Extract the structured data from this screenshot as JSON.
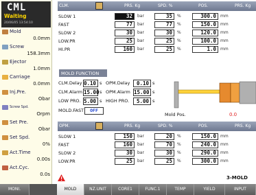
{
  "app": {
    "logo": "CML",
    "status": "Waiting",
    "datetime": "20/06/05 13:54:10"
  },
  "left_stats": [
    {
      "label": "Mold",
      "value": "0.0mm",
      "color": "#c08040"
    },
    {
      "label": "Screw",
      "value": "158.3mm",
      "color": "#80a0c0"
    },
    {
      "label": "Ejector",
      "value": "1.0mm",
      "color": "#c0a040"
    },
    {
      "label": "Carriage",
      "value": "0.0mm",
      "color": "#e8b040"
    },
    {
      "label": "Inj.Pre.",
      "value": "Obar",
      "color": "#d09040"
    },
    {
      "label": "Screw Spd.",
      "value": "Orpm",
      "color": "#8080c0"
    },
    {
      "label": "Set Pre.",
      "value": "Obar",
      "color": "#d09040"
    },
    {
      "label": "Set Spd.",
      "value": "0%",
      "color": "#d09040"
    },
    {
      "label": "Act.Time",
      "value": "0.00s",
      "color": "#d0a040"
    },
    {
      "label": "Act.Cyc.",
      "value": "0.0s",
      "color": "#c06040"
    }
  ],
  "close_table": {
    "headers": {
      "name": "CLM.",
      "prs": "PRS. Kg",
      "spd": "SPD. %",
      "pos": "POS.",
      "prs2": "PRS. Kg"
    },
    "rows": [
      {
        "name": "SLOW 1",
        "prs": "32",
        "spd": "35",
        "pos": "300.0"
      },
      {
        "name": "FAST",
        "prs": "77",
        "spd": "77",
        "pos": "150.0"
      },
      {
        "name": "SLOW 2",
        "prs": "30",
        "spd": "30",
        "pos": "120.0"
      },
      {
        "name": "LOW.PR",
        "prs": "25",
        "spd": "25",
        "pos": "100.0"
      },
      {
        "name": "HI.PR",
        "prs": "160",
        "spd": "25",
        "pos": "1.0"
      }
    ]
  },
  "units": {
    "bar": "bar",
    "pct": "%",
    "mm": "mm",
    "s": "s"
  },
  "mold_function": {
    "title": "MOLD FUNCTION",
    "clm_delay_label": "CLM.Delay",
    "clm_delay": "0.10",
    "opm_delay_label": "OPM.Delay",
    "opm_delay": "0.10",
    "clm_alarm_label": "CLM.Alarm",
    "clm_alarm": "15.00",
    "opm_alarm_label": "OPM.Alarm",
    "opm_alarm": "15.00",
    "low_pro_label": "LOW PRO.",
    "low_pro": "5.00",
    "high_pro_label": "HIGH PRO.",
    "high_pro": "5.00",
    "mold_fast_label": "MOLD.FAST",
    "mold_fast": "OFF"
  },
  "mold_pos": {
    "label": "Mold Pos.",
    "value": "0.0"
  },
  "open_table": {
    "headers": {
      "name": "OPM.",
      "prs": "PRS. Kg",
      "spd": "SPD. %",
      "pos": "POS.",
      "prs2": "PRS. Kg"
    },
    "rows": [
      {
        "name": "SLOW 1",
        "prs": "150",
        "spd": "20",
        "pos": "150.0"
      },
      {
        "name": "FAST",
        "prs": "160",
        "spd": "70",
        "pos": "240.0"
      },
      {
        "name": "SLOW 2",
        "prs": "30",
        "spd": "30",
        "pos": "290.0"
      },
      {
        "name": "LOW.PR",
        "prs": "25",
        "spd": "25",
        "pos": "300.0"
      }
    ]
  },
  "message": {
    "code": "3-MOLD"
  },
  "tabs": [
    "MONI.",
    "MOLD",
    "NZ.UNIT",
    "CORE1",
    "FUNC.1",
    "TEMP",
    "YIELD",
    "INPUT"
  ],
  "colors": {
    "header": "#6e7890",
    "accent": "#ffd700",
    "tab_active": "#e8e8e8"
  }
}
